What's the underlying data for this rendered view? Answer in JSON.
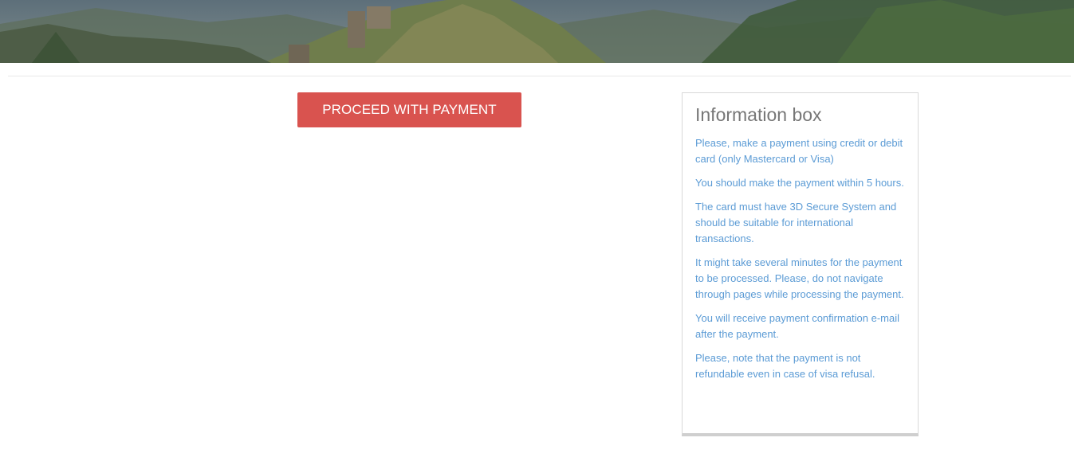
{
  "header": {
    "image_description_icon": "mountain-landscape-image"
  },
  "payment": {
    "button_label": "PROCEED WITH PAYMENT"
  },
  "info_box": {
    "title": "Information box",
    "items": [
      "Please, make a payment using credit or debit card (only Mastercard or Visa)",
      "You should make the payment within 5 hours.",
      "The card must have 3D Secure System and should be suitable for international transactions.",
      "It might take several minutes for the payment to be processed. Please, do not navigate through pages while processing the payment.",
      "You will receive payment confirmation e-mail after the payment.",
      "Please, note that the payment is not refundable even in case of visa refusal."
    ]
  },
  "colors": {
    "button": "#d9534f",
    "info_text": "#5b9bd5",
    "title_text": "#777777"
  }
}
